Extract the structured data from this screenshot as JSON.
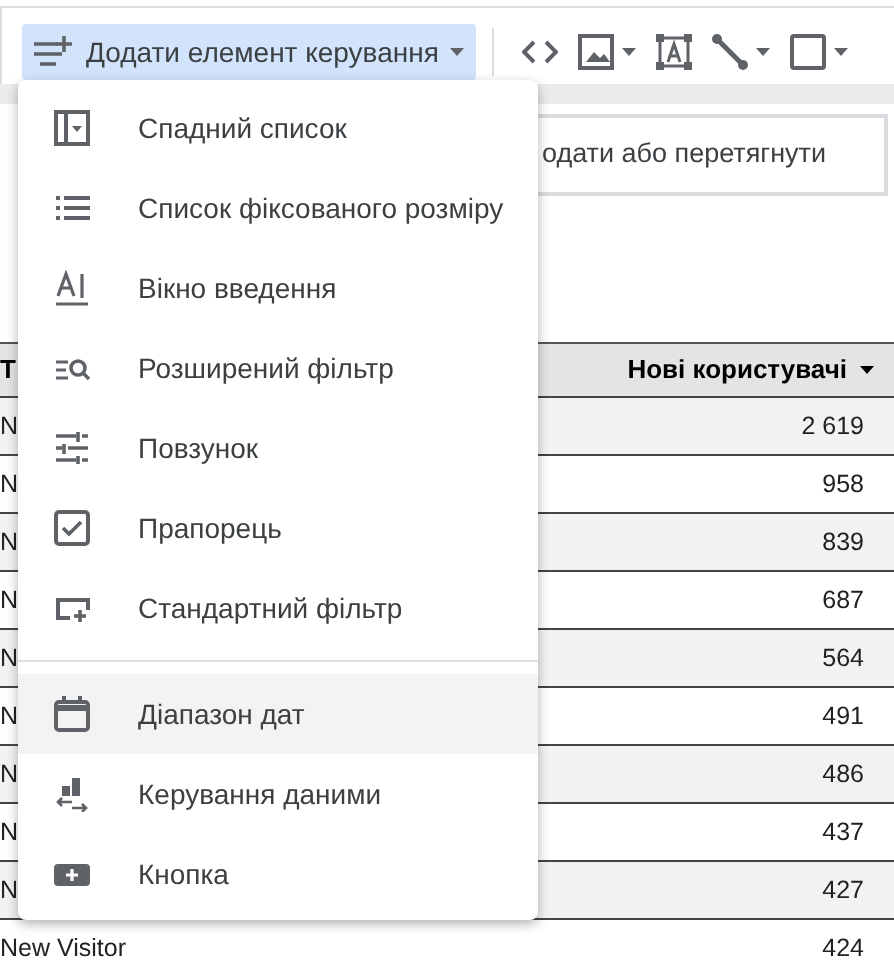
{
  "toolbar": {
    "add_control": {
      "label": "Додати елемент керування",
      "active": true
    },
    "tools": [
      {
        "kind": "code",
        "caret": false
      },
      {
        "kind": "image",
        "caret": true
      },
      {
        "kind": "textbox",
        "caret": false
      },
      {
        "kind": "line",
        "caret": true
      },
      {
        "kind": "shape",
        "caret": true
      }
    ]
  },
  "canvas": {
    "drop_zone": {
      "text": "одати або перетягнути"
    }
  },
  "table": {
    "columns": [
      "T",
      "Нові користувачі"
    ],
    "sort_desc": true,
    "rows": [
      {
        "cells": [
          "N",
          "2 619"
        ]
      },
      {
        "cells": [
          "N",
          "958"
        ]
      },
      {
        "cells": [
          "N",
          "839"
        ]
      },
      {
        "cells": [
          "N",
          "687"
        ]
      },
      {
        "cells": [
          "N",
          "564"
        ]
      },
      {
        "cells": [
          "N",
          "491"
        ]
      },
      {
        "cells": [
          "N",
          "486"
        ]
      },
      {
        "cells": [
          "N",
          "437"
        ]
      },
      {
        "cells": [
          "N",
          "427"
        ]
      },
      {
        "cells": [
          "New Visitor",
          "424"
        ]
      }
    ]
  },
  "menu": {
    "groups": [
      [
        {
          "kind": "dropdown",
          "label": "Спадний список",
          "selected": false
        },
        {
          "kind": "fixed-list",
          "label": "Список фіксованого розміру",
          "selected": false
        },
        {
          "kind": "input",
          "label": "Вікно введення",
          "selected": false
        },
        {
          "kind": "advanced-filter",
          "label": "Розширений фільтр",
          "selected": false
        },
        {
          "kind": "slider",
          "label": "Повзунок",
          "selected": false
        },
        {
          "kind": "checkbox",
          "label": "Прапорець",
          "selected": false
        },
        {
          "kind": "standard-filter",
          "label": "Стандартний фільтр",
          "selected": false
        }
      ],
      [
        {
          "kind": "date-range",
          "label": "Діапазон дат",
          "selected": true
        },
        {
          "kind": "data-control",
          "label": "Керування даними",
          "selected": false
        },
        {
          "kind": "button",
          "label": "Кнопка",
          "selected": false
        }
      ]
    ]
  }
}
